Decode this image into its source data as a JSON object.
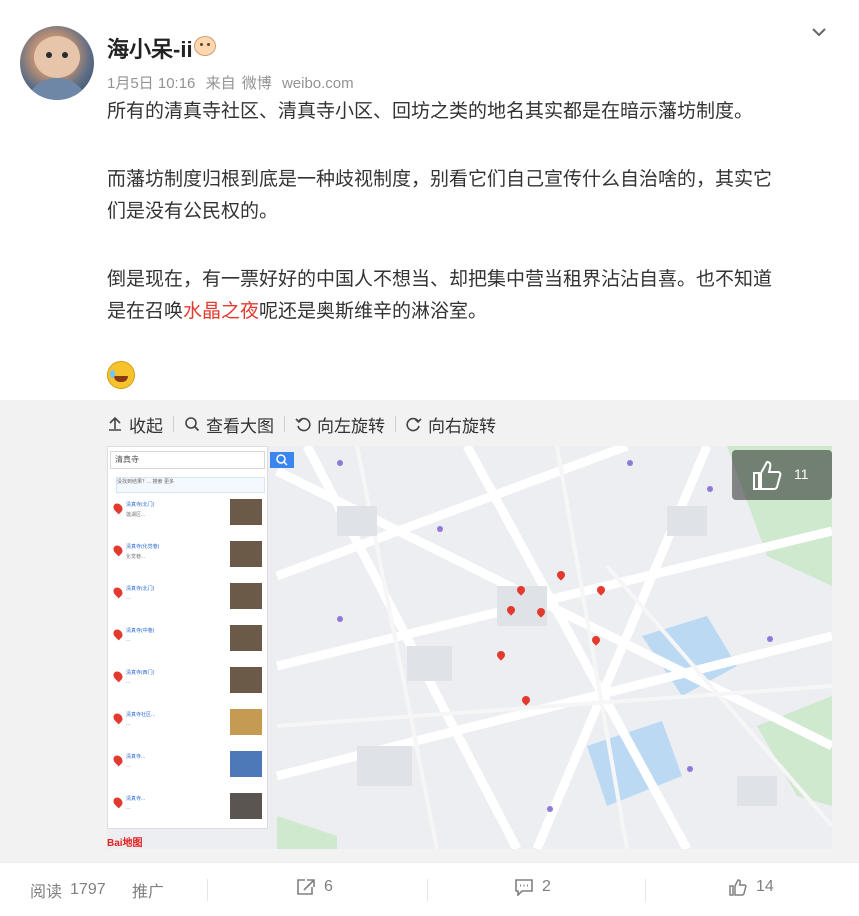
{
  "post": {
    "username": "海小呆-ii",
    "date": "1月5日 10:16",
    "source_prefix": "来自",
    "source_app": "微博",
    "source_domain": "weibo.com",
    "p1": "所有的清真寺社区、清真寺小区、回坊之类的地名其实都是在暗示藩坊制度。",
    "p2_l1": "而藩坊制度归根到底是一种歧视制度，别看它们自己宣传什么自治啥的，其实它",
    "p2_l2": "们是没有公民权的。",
    "p3_l1": "倒是现在，有一票好好的中国人不想当、却把集中营当租界沾沾自喜。也不知道",
    "p3_l2_pre": "是在召唤",
    "p3_l2_link": "水晶之夜",
    "p3_l2_post": "呢还是奥斯维辛的淋浴室。"
  },
  "toolbar": {
    "collapse": "收起",
    "view_large": "查看大图",
    "rotate_left": "向左旋转",
    "rotate_right": "向右旋转"
  },
  "image_like_count": "11",
  "map": {
    "search_value": "清真寺",
    "logo": "Bai地图",
    "notice": "没找到结果？... 搜索 更多",
    "results": [
      {
        "title": "清真寺(北门)",
        "addr": "莲湖区..."
      },
      {
        "title": "清真寺(化觉巷)",
        "addr": "化觉巷..."
      },
      {
        "title": "清真寺(北门)",
        "addr": "..."
      },
      {
        "title": "清真寺(中巷)",
        "addr": "..."
      },
      {
        "title": "清真寺(西门)",
        "addr": "..."
      },
      {
        "title": "清真寺社区...",
        "addr": "..."
      },
      {
        "title": "清真寺...",
        "addr": "..."
      },
      {
        "title": "清真寺...",
        "addr": "..."
      }
    ]
  },
  "footer": {
    "read_label": "阅读",
    "read_count": "1797",
    "promote": "推广",
    "share_count": "6",
    "comment_count": "2",
    "like_count": "14"
  },
  "colors": {
    "accent": "#e33a2f",
    "link_blue": "#3a85ee",
    "meta_gray": "#939393"
  },
  "icons": [
    "chevron-down-icon",
    "collapse-icon",
    "search-icon",
    "rotate-left-icon",
    "rotate-right-icon",
    "thumbs-up-icon",
    "share-icon",
    "comment-icon",
    "like-icon"
  ]
}
